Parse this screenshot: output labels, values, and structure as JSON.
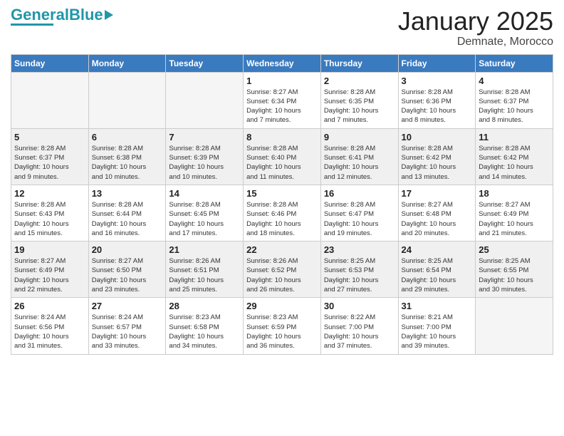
{
  "header": {
    "logo_general": "General",
    "logo_blue": "Blue",
    "title": "January 2025",
    "subtitle": "Demnate, Morocco"
  },
  "weekdays": [
    "Sunday",
    "Monday",
    "Tuesday",
    "Wednesday",
    "Thursday",
    "Friday",
    "Saturday"
  ],
  "weeks": [
    [
      {
        "day": "",
        "empty": true
      },
      {
        "day": "",
        "empty": true
      },
      {
        "day": "",
        "empty": true
      },
      {
        "day": "1",
        "sunrise": "8:27 AM",
        "sunset": "6:34 PM",
        "daylight": "10 hours and 7 minutes."
      },
      {
        "day": "2",
        "sunrise": "8:28 AM",
        "sunset": "6:35 PM",
        "daylight": "10 hours and 7 minutes."
      },
      {
        "day": "3",
        "sunrise": "8:28 AM",
        "sunset": "6:36 PM",
        "daylight": "10 hours and 8 minutes."
      },
      {
        "day": "4",
        "sunrise": "8:28 AM",
        "sunset": "6:37 PM",
        "daylight": "10 hours and 8 minutes."
      }
    ],
    [
      {
        "day": "5",
        "sunrise": "8:28 AM",
        "sunset": "6:37 PM",
        "daylight": "10 hours and 9 minutes."
      },
      {
        "day": "6",
        "sunrise": "8:28 AM",
        "sunset": "6:38 PM",
        "daylight": "10 hours and 10 minutes."
      },
      {
        "day": "7",
        "sunrise": "8:28 AM",
        "sunset": "6:39 PM",
        "daylight": "10 hours and 10 minutes."
      },
      {
        "day": "8",
        "sunrise": "8:28 AM",
        "sunset": "6:40 PM",
        "daylight": "10 hours and 11 minutes."
      },
      {
        "day": "9",
        "sunrise": "8:28 AM",
        "sunset": "6:41 PM",
        "daylight": "10 hours and 12 minutes."
      },
      {
        "day": "10",
        "sunrise": "8:28 AM",
        "sunset": "6:42 PM",
        "daylight": "10 hours and 13 minutes."
      },
      {
        "day": "11",
        "sunrise": "8:28 AM",
        "sunset": "6:42 PM",
        "daylight": "10 hours and 14 minutes."
      }
    ],
    [
      {
        "day": "12",
        "sunrise": "8:28 AM",
        "sunset": "6:43 PM",
        "daylight": "10 hours and 15 minutes."
      },
      {
        "day": "13",
        "sunrise": "8:28 AM",
        "sunset": "6:44 PM",
        "daylight": "10 hours and 16 minutes."
      },
      {
        "day": "14",
        "sunrise": "8:28 AM",
        "sunset": "6:45 PM",
        "daylight": "10 hours and 17 minutes."
      },
      {
        "day": "15",
        "sunrise": "8:28 AM",
        "sunset": "6:46 PM",
        "daylight": "10 hours and 18 minutes."
      },
      {
        "day": "16",
        "sunrise": "8:28 AM",
        "sunset": "6:47 PM",
        "daylight": "10 hours and 19 minutes."
      },
      {
        "day": "17",
        "sunrise": "8:27 AM",
        "sunset": "6:48 PM",
        "daylight": "10 hours and 20 minutes."
      },
      {
        "day": "18",
        "sunrise": "8:27 AM",
        "sunset": "6:49 PM",
        "daylight": "10 hours and 21 minutes."
      }
    ],
    [
      {
        "day": "19",
        "sunrise": "8:27 AM",
        "sunset": "6:49 PM",
        "daylight": "10 hours and 22 minutes."
      },
      {
        "day": "20",
        "sunrise": "8:27 AM",
        "sunset": "6:50 PM",
        "daylight": "10 hours and 23 minutes."
      },
      {
        "day": "21",
        "sunrise": "8:26 AM",
        "sunset": "6:51 PM",
        "daylight": "10 hours and 25 minutes."
      },
      {
        "day": "22",
        "sunrise": "8:26 AM",
        "sunset": "6:52 PM",
        "daylight": "10 hours and 26 minutes."
      },
      {
        "day": "23",
        "sunrise": "8:25 AM",
        "sunset": "6:53 PM",
        "daylight": "10 hours and 27 minutes."
      },
      {
        "day": "24",
        "sunrise": "8:25 AM",
        "sunset": "6:54 PM",
        "daylight": "10 hours and 29 minutes."
      },
      {
        "day": "25",
        "sunrise": "8:25 AM",
        "sunset": "6:55 PM",
        "daylight": "10 hours and 30 minutes."
      }
    ],
    [
      {
        "day": "26",
        "sunrise": "8:24 AM",
        "sunset": "6:56 PM",
        "daylight": "10 hours and 31 minutes."
      },
      {
        "day": "27",
        "sunrise": "8:24 AM",
        "sunset": "6:57 PM",
        "daylight": "10 hours and 33 minutes."
      },
      {
        "day": "28",
        "sunrise": "8:23 AM",
        "sunset": "6:58 PM",
        "daylight": "10 hours and 34 minutes."
      },
      {
        "day": "29",
        "sunrise": "8:23 AM",
        "sunset": "6:59 PM",
        "daylight": "10 hours and 36 minutes."
      },
      {
        "day": "30",
        "sunrise": "8:22 AM",
        "sunset": "7:00 PM",
        "daylight": "10 hours and 37 minutes."
      },
      {
        "day": "31",
        "sunrise": "8:21 AM",
        "sunset": "7:00 PM",
        "daylight": "10 hours and 39 minutes."
      },
      {
        "day": "",
        "empty": true
      }
    ]
  ]
}
